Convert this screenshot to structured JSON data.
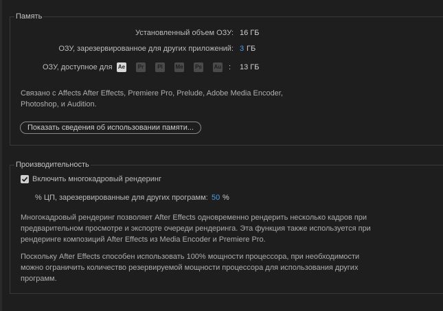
{
  "memory": {
    "title": "Память",
    "installed_label": "Установленный объем ОЗУ:",
    "installed_value": "16 ГБ",
    "reserved_label": "ОЗУ, зарезервированное для других приложений:",
    "reserved_value": "3",
    "reserved_unit": "ГБ",
    "available_label": "ОЗУ, доступное для",
    "apps": [
      {
        "label": "Ae",
        "active": true
      },
      {
        "label": "Pr",
        "active": false
      },
      {
        "label": "Pl",
        "active": false
      },
      {
        "label": "Me",
        "active": false
      },
      {
        "label": "Ps",
        "active": false
      },
      {
        "label": "Au",
        "active": false
      }
    ],
    "available_separator": ":",
    "available_value": "13 ГБ",
    "linked_text_line1": "Связано с Affects After Effects, Premiere Pro, Prelude, Adobe Media Encoder,",
    "linked_text_line2": "Photoshop, и Audition.",
    "show_usage_button": "Показать сведения об использовании памяти..."
  },
  "performance": {
    "title": "Производительность",
    "multiframe_checkbox_label": "Включить многокадровый рендеринг",
    "multiframe_checked": true,
    "cpu_label": "% ЦП, зарезервированные для других программ:",
    "cpu_value": "50",
    "cpu_unit": "%",
    "desc1_line1": "Многокадровый рендеринг позволяет After Effects одновременно рендерить несколько кадров при",
    "desc1_line2": "предварительном просмотре и экспорте очереди рендеринга. Эта функция также используется при",
    "desc1_line3": "рендеринге композиций After Effects из Media Encoder и Premiere Pro.",
    "desc2_line1": "Поскольку After Effects способен использовать 100% мощности процессора, при необходимости",
    "desc2_line2": "можно ограничить количество резервируемой мощности процессора для использования других",
    "desc2_line3": "программ."
  },
  "colors": {
    "background": "#1e1e1e",
    "link_value": "#4e9ee7",
    "border": "#3a3a3a"
  }
}
